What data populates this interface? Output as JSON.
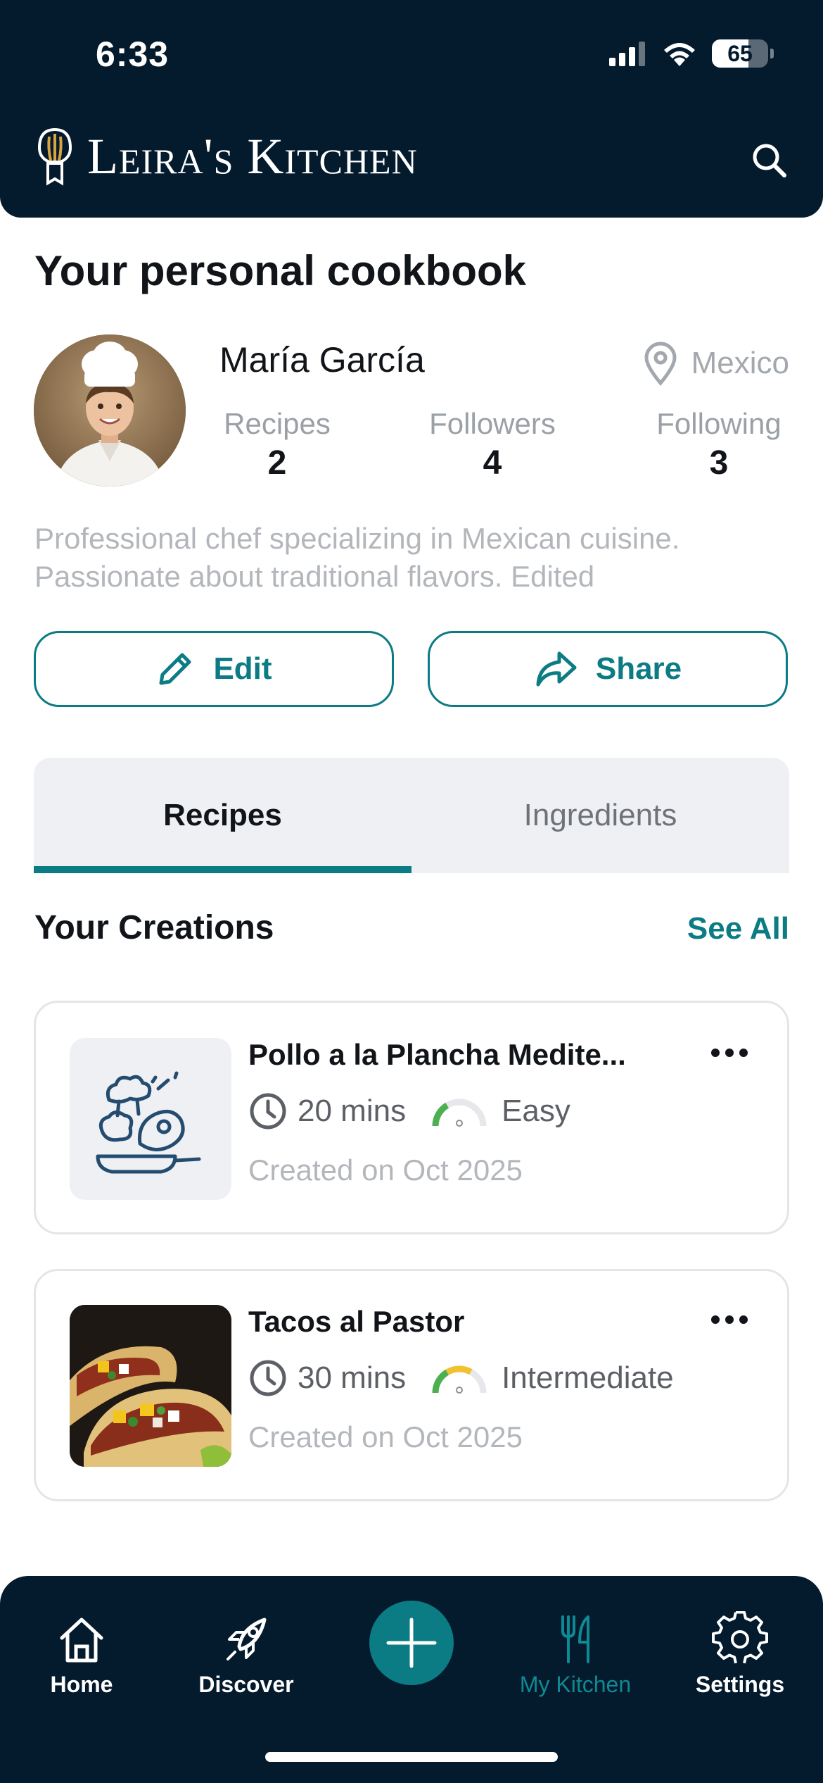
{
  "status_bar": {
    "time": "6:33",
    "battery": "65"
  },
  "header": {
    "app_title": "Leira's Kitchen"
  },
  "profile": {
    "page_title": "Your personal cookbook",
    "name": "María García",
    "location": "Mexico",
    "stats": [
      {
        "label": "Recipes",
        "value": "2"
      },
      {
        "label": "Followers",
        "value": "4"
      },
      {
        "label": "Following",
        "value": "3"
      }
    ],
    "bio": "Professional chef specializing in Mexican cuisine. Passionate about traditional flavors. Edited",
    "edit_label": "Edit",
    "share_label": "Share"
  },
  "tabs": [
    {
      "label": "Recipes",
      "active": true
    },
    {
      "label": "Ingredients",
      "active": false
    }
  ],
  "section": {
    "title": "Your Creations",
    "see_all": "See All"
  },
  "recipes": [
    {
      "title": "Pollo a la Plancha Medite...",
      "time": "20 mins",
      "difficulty": "Easy",
      "difficulty_level": 0.33,
      "created": "Created on Oct 2025",
      "thumbnail": "cooking-placeholder-icon"
    },
    {
      "title": "Tacos al Pastor",
      "time": "30 mins",
      "difficulty": "Intermediate",
      "difficulty_level": 0.66,
      "created": "Created on Oct 2025",
      "thumbnail": "tacos-photo"
    }
  ],
  "bottom_nav": [
    {
      "label": "Home",
      "icon": "home-icon"
    },
    {
      "label": "Discover",
      "icon": "rocket-icon"
    },
    {
      "label": "",
      "icon": "plus-icon"
    },
    {
      "label": "My Kitchen",
      "icon": "fork-knife-icon",
      "active": true
    },
    {
      "label": "Settings",
      "icon": "gear-icon"
    }
  ],
  "colors": {
    "header_bg": "#041a2d",
    "accent": "#0b7b84",
    "muted_text": "#b3b7bc"
  }
}
